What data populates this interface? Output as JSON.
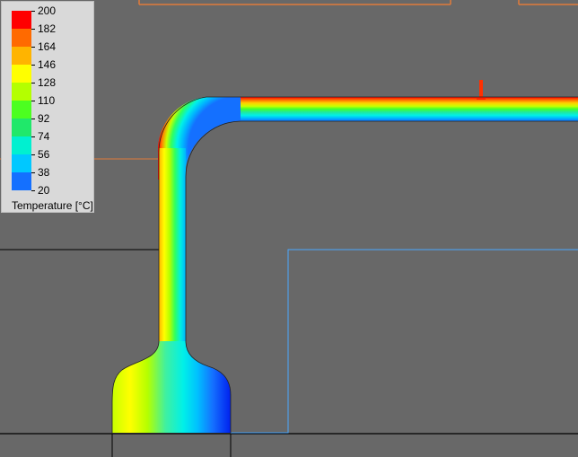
{
  "legend": {
    "title": "Temperature [°C]",
    "labels": [
      "200",
      "182",
      "164",
      "146",
      "128",
      "110",
      "92",
      "74",
      "56",
      "38",
      "20"
    ],
    "colors": [
      "#ff0000",
      "#ff6a00",
      "#ffb400",
      "#ffff00",
      "#b4ff00",
      "#4cff20",
      "#20e86a",
      "#00f0d0",
      "#00c8ff",
      "#1470ff",
      "#0000ee"
    ]
  },
  "colors": {
    "background": "#686868",
    "model_edge": "#000000",
    "orange_edge": "#e07a3a",
    "blue_edge": "#4aa8ff"
  }
}
